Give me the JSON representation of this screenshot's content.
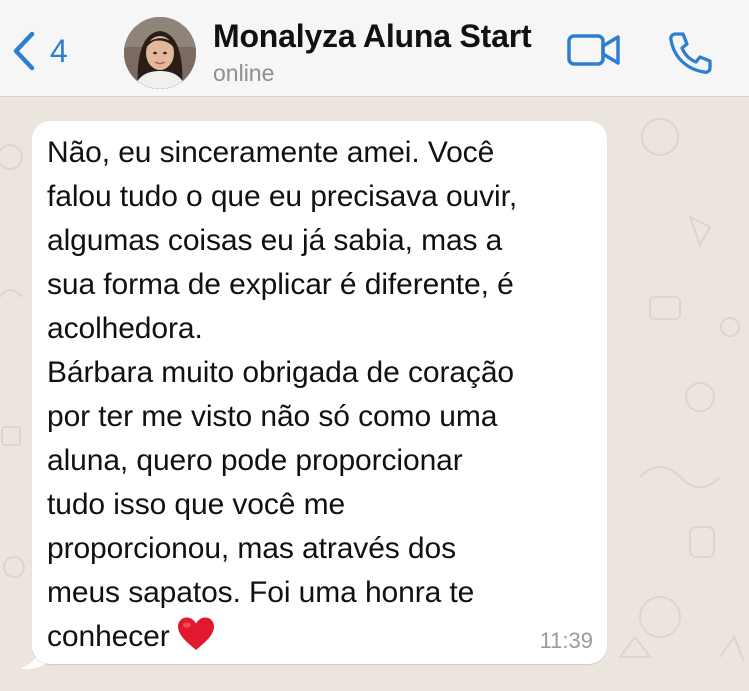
{
  "header": {
    "back_count": "4",
    "contact_name": "Monalyza Aluna Start",
    "contact_status": "online",
    "accent_color": "#2c7fd0"
  },
  "icons": {
    "back": "chevron-left-icon",
    "video": "video-camera-icon",
    "call": "phone-icon",
    "heart": "red-heart-emoji"
  },
  "message": {
    "lines": [
      "Não, eu sinceramente amei. Você",
      "falou tudo o que eu precisava ouvir,",
      "algumas coisas eu já sabia, mas a",
      "sua forma de explicar é diferente, é",
      "acolhedora.",
      "Bárbara muito obrigada de coração",
      "por ter me visto não só como uma",
      "aluna, quero pode proporcionar",
      "tudo isso que você me",
      "proporcionou, mas através dos",
      "meus sapatos. Foi uma honra te",
      "conhecer"
    ],
    "time": "11:39"
  }
}
